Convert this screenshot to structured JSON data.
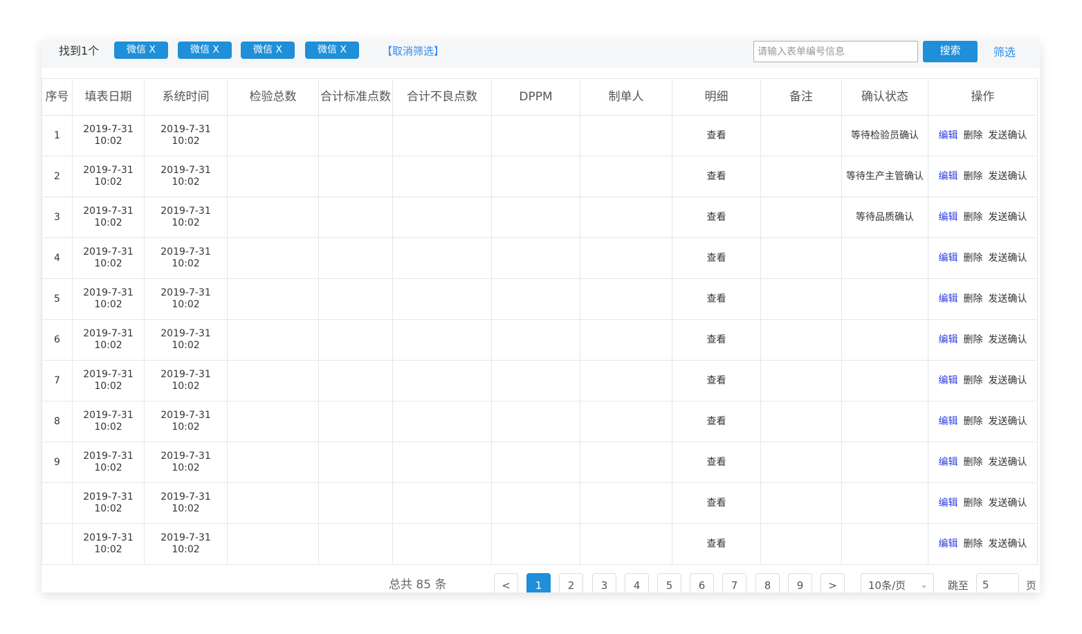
{
  "filter_bar": {
    "found_text": "找到1个",
    "tags": [
      "微信 X",
      "微信 X",
      "微信 X",
      "微信 X"
    ],
    "cancel_label": "【取消筛选】",
    "search_placeholder": "请输入表单编号信息",
    "search_label": "搜索",
    "filter_label": "筛选"
  },
  "table": {
    "headers": [
      "序号",
      "填表日期",
      "系统时间",
      "检验总数",
      "合计标准点数",
      "合计不良点数",
      "DPPM",
      "制单人",
      "明细",
      "备注",
      "确认状态",
      "操作"
    ],
    "rows": [
      {
        "index": "1",
        "fill_date": "2019-7-31",
        "fill_time": "10:02",
        "sys_date": "2019-7-31",
        "sys_time": "10:02",
        "detail": "查看",
        "status": "等待检验员确认"
      },
      {
        "index": "2",
        "fill_date": "2019-7-31",
        "fill_time": "10:02",
        "sys_date": "2019-7-31",
        "sys_time": "10:02",
        "detail": "查看",
        "status": "等待生产主管确认"
      },
      {
        "index": "3",
        "fill_date": "2019-7-31",
        "fill_time": "10:02",
        "sys_date": "2019-7-31",
        "sys_time": "10:02",
        "detail": "查看",
        "status": "等待品质确认"
      },
      {
        "index": "4",
        "fill_date": "2019-7-31",
        "fill_time": "10:02",
        "sys_date": "2019-7-31",
        "sys_time": "10:02",
        "detail": "查看",
        "status": ""
      },
      {
        "index": "5",
        "fill_date": "2019-7-31",
        "fill_time": "10:02",
        "sys_date": "2019-7-31",
        "sys_time": "10:02",
        "detail": "查看",
        "status": ""
      },
      {
        "index": "6",
        "fill_date": "2019-7-31",
        "fill_time": "10:02",
        "sys_date": "2019-7-31",
        "sys_time": "10:02",
        "detail": "查看",
        "status": ""
      },
      {
        "index": "7",
        "fill_date": "2019-7-31",
        "fill_time": "10:02",
        "sys_date": "2019-7-31",
        "sys_time": "10:02",
        "detail": "查看",
        "status": ""
      },
      {
        "index": "8",
        "fill_date": "2019-7-31",
        "fill_time": "10:02",
        "sys_date": "2019-7-31",
        "sys_time": "10:02",
        "detail": "查看",
        "status": ""
      },
      {
        "index": "9",
        "fill_date": "2019-7-31",
        "fill_time": "10:02",
        "sys_date": "2019-7-31",
        "sys_time": "10:02",
        "detail": "查看",
        "status": ""
      },
      {
        "index": "",
        "fill_date": "2019-7-31",
        "fill_time": "10:02",
        "sys_date": "2019-7-31",
        "sys_time": "10:02",
        "detail": "查看",
        "status": ""
      },
      {
        "index": "",
        "fill_date": "2019-7-31",
        "fill_time": "10:02",
        "sys_date": "2019-7-31",
        "sys_time": "10:02",
        "detail": "查看",
        "status": ""
      }
    ],
    "actions": {
      "edit": "编辑",
      "delete": "删除",
      "send": "发送确认"
    }
  },
  "pagination": {
    "total_text": "总共 85 条",
    "prev": "<",
    "next": ">",
    "pages": [
      "1",
      "2",
      "3",
      "4",
      "5",
      "6",
      "7",
      "8",
      "9"
    ],
    "current_page": "1",
    "page_size": "10条/页",
    "jump_label": "跳至",
    "jump_value": "5",
    "page_label": "页"
  },
  "colors": {
    "primary": "#1e8fd8",
    "link": "#2d8cf0",
    "edit": "#2f3de0",
    "filter_bg": "#f5f6f7"
  }
}
